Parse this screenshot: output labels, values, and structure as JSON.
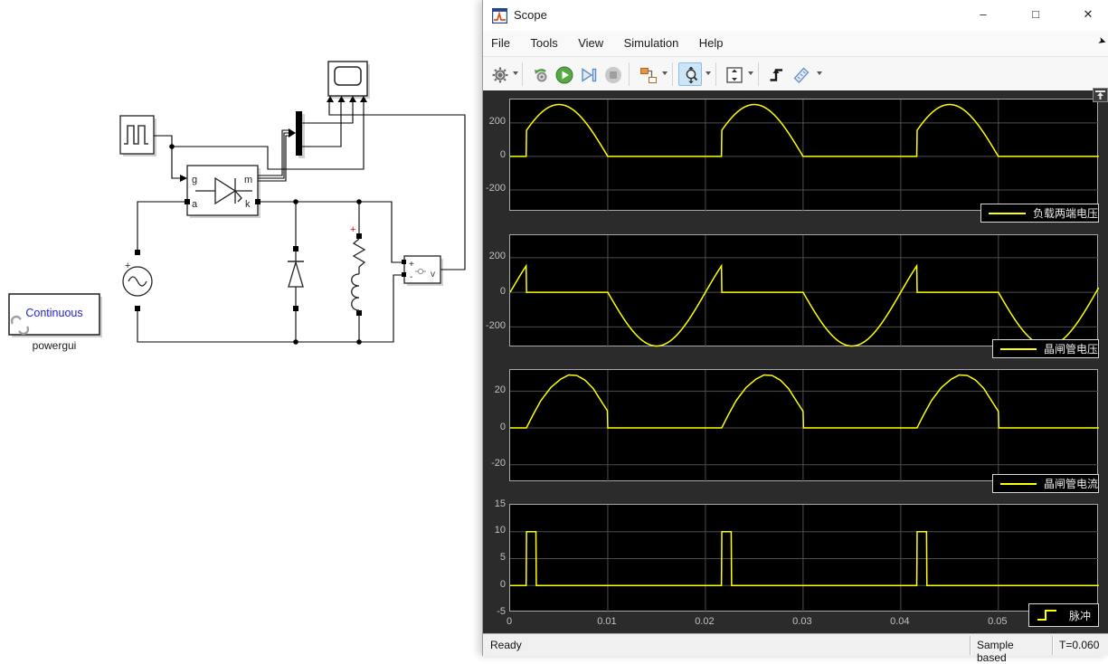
{
  "window": {
    "title": "Scope",
    "controls": {
      "minimize": "–",
      "maximize": "□",
      "close": "✕"
    }
  },
  "menu": {
    "items": [
      "File",
      "Tools",
      "View",
      "Simulation",
      "Help"
    ]
  },
  "toolbar": {
    "icons": [
      "settings-gear",
      "simulation-settings",
      "run",
      "step-forward",
      "stop",
      "signal-selector",
      "zoom-y",
      "fit-to-view",
      "trigger",
      "measurements"
    ],
    "selected_tool": "zoom-y"
  },
  "status": {
    "left": "Ready",
    "mode": "Sample based",
    "time": "T=0.060"
  },
  "diagram": {
    "powergui": {
      "mode": "Continuous",
      "label": "powergui"
    },
    "thyristor_ports": {
      "g": "g",
      "m": "m",
      "a": "a",
      "k": "k"
    },
    "vmeas": {
      "plus": "+",
      "minus": "-",
      "label": "v"
    },
    "source_plus": "+",
    "rl_plus": "+"
  },
  "chart_data": {
    "type": "line",
    "title": "",
    "trace_color": "#ffff00",
    "bg": "#000000",
    "grid_color": "#4e4e4e",
    "border_color": "#a8a8a8",
    "legend_position": "bottom-right",
    "x_axis": {
      "min": 0,
      "max": 0.0603,
      "ticks": [
        0,
        0.01,
        0.02,
        0.03,
        0.04,
        0.05
      ],
      "tick_labels": [
        "0",
        "0.01",
        "0.02",
        "0.03",
        "0.04",
        "0.05"
      ]
    },
    "signal_params": {
      "frequency_hz": 50,
      "period_s": 0.02,
      "firing_time_s": 0.0016667,
      "conduction_end_s": 0.01,
      "source_amplitude_v": 310,
      "voltage_at_firing_v": 155,
      "peak_current_a": 28.8,
      "current_at_turnoff_a": 9,
      "pulse_height": 10,
      "pulse_width_s": 0.001
    },
    "subplots": [
      {
        "name": "load-voltage",
        "legend": "负载两端电压",
        "kind": "gated_sine",
        "ylim": [
          -330,
          340
        ],
        "yticks": [
          200,
          0,
          -200
        ],
        "ytick_labels": [
          "200",
          "0",
          "-200"
        ]
      },
      {
        "name": "thyristor-voltage",
        "legend": "晶闸管电压",
        "kind": "blocked_sine",
        "ylim": [
          -318,
          330
        ],
        "yticks": [
          200,
          0,
          -200
        ],
        "ytick_labels": [
          "200",
          "0",
          "-200"
        ]
      },
      {
        "name": "thyristor-current",
        "legend": "晶闸管电流",
        "kind": "current_hump",
        "ylim": [
          -29.5,
          31.5
        ],
        "yticks": [
          20,
          0,
          -20
        ],
        "ytick_labels": [
          "20",
          "0",
          "-20"
        ],
        "hump_u": [
          0,
          0.08,
          0.18,
          0.3,
          0.42,
          0.52,
          0.62,
          0.72,
          0.82,
          0.92,
          1.0
        ],
        "hump_y": [
          0,
          7,
          15,
          22,
          26.5,
          28.8,
          28.5,
          26,
          21.5,
          14.5,
          9
        ]
      },
      {
        "name": "gate-pulse",
        "legend": "脉冲",
        "kind": "pulse_train",
        "legend_style": "stair",
        "ylim": [
          -5,
          15
        ],
        "yticks": [
          15,
          10,
          5,
          0,
          -5
        ],
        "ytick_labels": [
          "15",
          "10",
          "5",
          "0",
          "-5"
        ]
      }
    ]
  }
}
